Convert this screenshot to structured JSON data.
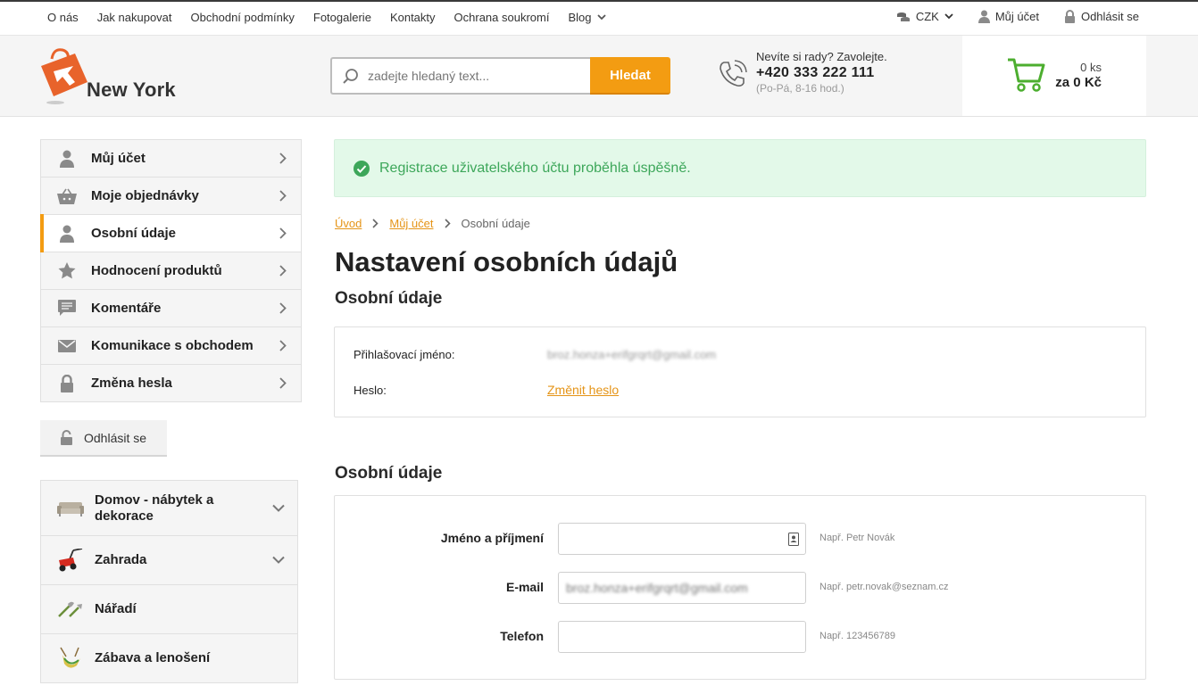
{
  "topbar": {
    "nav": [
      "O nás",
      "Jak nakupovat",
      "Obchodní podmínky",
      "Fotogalerie",
      "Kontakty",
      "Ochrana soukromí",
      "Blog"
    ],
    "currency": "CZK",
    "account": "Můj účet",
    "logout": "Odhlásit se"
  },
  "header": {
    "logo_text": "New York",
    "search_placeholder": "zadejte hledaný text...",
    "search_button": "Hledat",
    "phone_question": "Nevíte si rady? Zavolejte.",
    "phone_number": "+420 333 222 111",
    "phone_hours": "(Po-Pá, 8-16 hod.)",
    "cart_count": "0 ks",
    "cart_price": "za 0 Kč"
  },
  "account_menu": [
    {
      "label": "Můj účet",
      "icon": "user-icon"
    },
    {
      "label": "Moje objednávky",
      "icon": "basket-icon"
    },
    {
      "label": "Osobní údaje",
      "icon": "user-icon",
      "active": true
    },
    {
      "label": "Hodnocení produktů",
      "icon": "star-icon"
    },
    {
      "label": "Komentáře",
      "icon": "comment-icon"
    },
    {
      "label": "Komunikace s obchodem",
      "icon": "envelope-icon"
    },
    {
      "label": "Změna hesla",
      "icon": "lock-icon"
    }
  ],
  "logout_button": "Odhlásit se",
  "categories": [
    {
      "label": "Domov - nábytek a dekorace",
      "expandable": true
    },
    {
      "label": "Zahrada",
      "expandable": true
    },
    {
      "label": "Nářadí",
      "expandable": false
    },
    {
      "label": "Zábava a lenošení",
      "expandable": false
    }
  ],
  "alert": "Registrace uživatelského účtu proběhla úspěšně.",
  "breadcrumb": [
    "Úvod",
    "Můj účet",
    "Osobní údaje"
  ],
  "page_title": "Nastavení osobních údajů",
  "section1": {
    "title": "Osobní údaje",
    "login_label": "Přihlašovací jméno:",
    "login_value": "broz.honza+erifgrqrt@gmail.com",
    "password_label": "Heslo:",
    "password_link": "Změnit heslo"
  },
  "section2": {
    "title": "Osobní údaje",
    "fields": [
      {
        "label": "Jméno a příjmení",
        "value": "",
        "hint": "Např. Petr Novák"
      },
      {
        "label": "E-mail",
        "value": "broz.honza+erifgrqrt@gmail.com",
        "hint": "Např. petr.novak@seznam.cz"
      },
      {
        "label": "Telefon",
        "value": "",
        "hint": "Např. 123456789"
      }
    ]
  },
  "colors": {
    "accent": "#f39c12",
    "success_bg": "#e3f9e9",
    "success_text": "#3da75a",
    "link": "#e59417"
  }
}
